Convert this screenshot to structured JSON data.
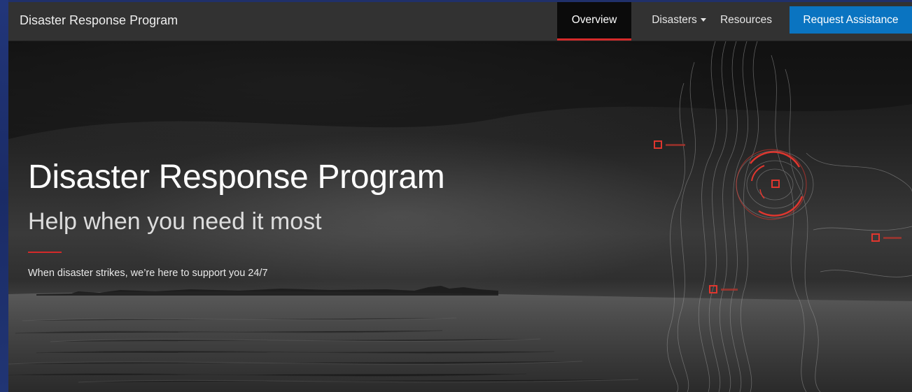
{
  "navbar": {
    "brand": "Disaster Response Program",
    "tabs": [
      {
        "label": "Overview",
        "active": true
      },
      {
        "label": "Disasters",
        "has_dropdown": true
      },
      {
        "label": "Resources"
      }
    ],
    "cta_label": "Request Assistance"
  },
  "hero": {
    "title": "Disaster Response Program",
    "subtitle": "Help when you need it most",
    "tagline": "When disaster strikes, we’re here to support you 24/7"
  },
  "colors": {
    "accent_red": "#d42a2a",
    "cta_blue": "#0a74c1",
    "navbar_bg": "#323232",
    "active_tab_bg": "#0b0b0b"
  },
  "icons": {
    "dropdown": "caret-down-icon",
    "map_markers": "square-target-icon",
    "radar": "circular-target-icon"
  }
}
